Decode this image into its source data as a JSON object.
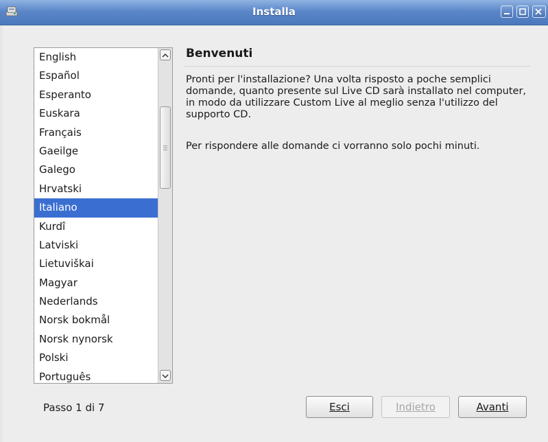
{
  "window": {
    "title": "Installa",
    "icon": "installer-disk-icon",
    "controls": [
      "minimize-icon",
      "maximize-icon",
      "close-icon"
    ]
  },
  "languages": {
    "items": [
      "English",
      "Español",
      "Esperanto",
      "Euskara",
      "Français",
      "Gaeilge",
      "Galego",
      "Hrvatski",
      "Italiano",
      "Kurdî",
      "Latviski",
      "Lietuviškai",
      "Magyar",
      "Nederlands",
      "Norsk bokmål",
      "Norsk nynorsk",
      "Polski",
      "Português"
    ],
    "selected": "Italiano"
  },
  "content": {
    "heading": "Benvenuti",
    "paragraph1": "Pronti per l'installazione? Una volta risposto a poche semplici domande, quanto presente sul Live CD sarà installato nel computer, in modo da utilizzare Custom Live al meglio senza l'utilizzo del supporto CD.",
    "paragraph2": "Per rispondere alle domande ci vorranno solo pochi minuti."
  },
  "footer": {
    "step": "Passo 1 di 7",
    "buttons": {
      "quit": "Esci",
      "back": "Indietro",
      "next": "Avanti"
    }
  },
  "colors": {
    "titlebar": "#5b87c8",
    "selection": "#3a6fd1"
  }
}
